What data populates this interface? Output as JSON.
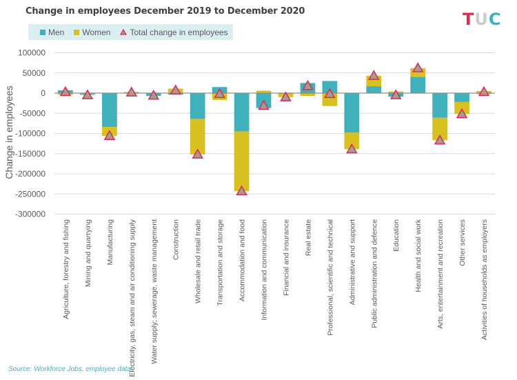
{
  "logo": {
    "t": "T",
    "u": "U",
    "c": "C"
  },
  "source": "Source: Workforce Jobs, employee data",
  "chart_data": {
    "type": "bar",
    "stacked": true,
    "title": "Change in employees December 2019 to December 2020",
    "xlabel": "",
    "ylabel": "Change in employees",
    "ylim": [
      -300000,
      100000
    ],
    "yticks": [
      100000,
      50000,
      0,
      -50000,
      -100000,
      -150000,
      -200000,
      -250000,
      -300000
    ],
    "grid": true,
    "legend_position": "top-left",
    "colors": {
      "men": "#3fb0bc",
      "women": "#d9c021",
      "marker_fill": "#a39e87",
      "marker_edge": "#e0245e"
    },
    "legend": [
      {
        "key": "men",
        "label": "Men"
      },
      {
        "key": "women",
        "label": "Women"
      },
      {
        "key": "total",
        "label": "Total change in employees"
      }
    ],
    "categories": [
      "Agriculture, forestry and fishing",
      "Mining and quarrying",
      "Manufacturing",
      "Electricity, gas, steam and air conditioning supply",
      "Water supply; sewerage, waste management",
      "Construction",
      "Wholesale and retail trade",
      "Transportation and storage",
      "Accommodation and food",
      "Information and communication",
      "Financial and insurance",
      "Real estate",
      "Professional, scientific and technical",
      "Administrative and support",
      "Public administration and defence",
      "Education",
      "Health and social work",
      "Arts, entertainment and recreation",
      "Other services",
      "Activities of households as employers"
    ],
    "series": [
      {
        "name": "Men",
        "values": [
          7000,
          -3000,
          -84000,
          -1000,
          -7000,
          -4000,
          -64000,
          15000,
          -95000,
          -37000,
          -2000,
          25000,
          30000,
          -98000,
          17000,
          -9000,
          40000,
          -61000,
          -22000,
          -2000
        ]
      },
      {
        "name": "Women",
        "values": [
          -4000,
          -2000,
          -22000,
          3000,
          1000,
          11000,
          -88000,
          -17000,
          -148000,
          6000,
          -8000,
          -7000,
          -32000,
          -41000,
          26000,
          4000,
          22000,
          -56000,
          -30000,
          5000
        ]
      },
      {
        "name": "Total change in employees",
        "values": [
          3000,
          -5000,
          -106000,
          2000,
          -6000,
          7000,
          -152000,
          -2000,
          -243000,
          -31000,
          -10000,
          18000,
          -2000,
          -139000,
          43000,
          -5000,
          62000,
          -117000,
          -52000,
          3000
        ]
      }
    ]
  }
}
